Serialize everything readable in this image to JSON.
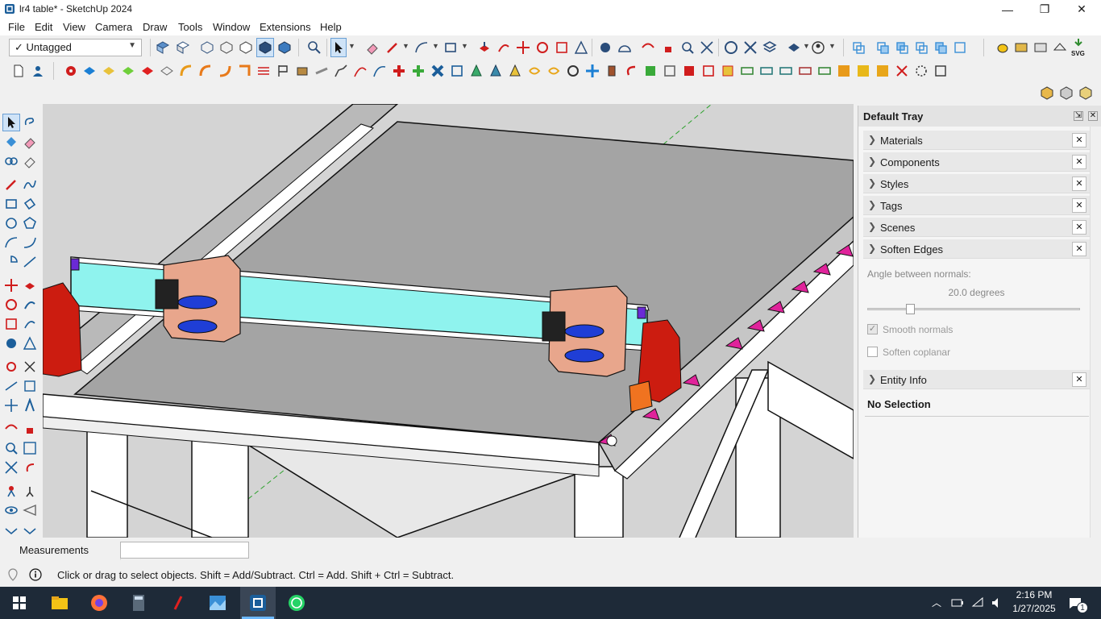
{
  "window": {
    "title": "lr4 table* - SketchUp 2024",
    "minimize": "—",
    "maximize": "❐",
    "close": "✕"
  },
  "menu": [
    "File",
    "Edit",
    "View",
    "Camera",
    "Draw",
    "Tools",
    "Window",
    "Extensions",
    "Help"
  ],
  "tags": {
    "selected": "Untagged",
    "check": "✓"
  },
  "toolbar_svg_label": "SVG",
  "tray": {
    "title": "Default Tray",
    "panels": [
      "Materials",
      "Components",
      "Styles",
      "Tags",
      "Scenes",
      "Soften Edges",
      "Entity Info"
    ],
    "soften_edges": {
      "angle_label": "Angle between normals:",
      "angle_value": "20.0  degrees",
      "angle_fraction": 0.2,
      "smooth_normals": "Smooth normals",
      "smooth_normals_checked": true,
      "soften_coplanar": "Soften coplanar",
      "soften_coplanar_checked": false
    },
    "entity_info": {
      "selection": "No Selection"
    }
  },
  "measurements": {
    "label": "Measurements",
    "value": ""
  },
  "status": {
    "hint": "Click or drag to select objects. Shift = Add/Subtract. Ctrl = Add. Shift + Ctrl = Subtract."
  },
  "taskbar": {
    "time": "2:16 PM",
    "date": "1/27/2025",
    "notifications": "1"
  },
  "colors": {
    "accent_blue": "#1b5e9a",
    "viewport_bg": "#d4d4d4",
    "taskbar_bg": "#1e2a38",
    "rail_cyan": "#8ff3ee",
    "carriage": "#e8a68c",
    "holder_red": "#cc1c10",
    "clip_pink": "#e0239b"
  }
}
